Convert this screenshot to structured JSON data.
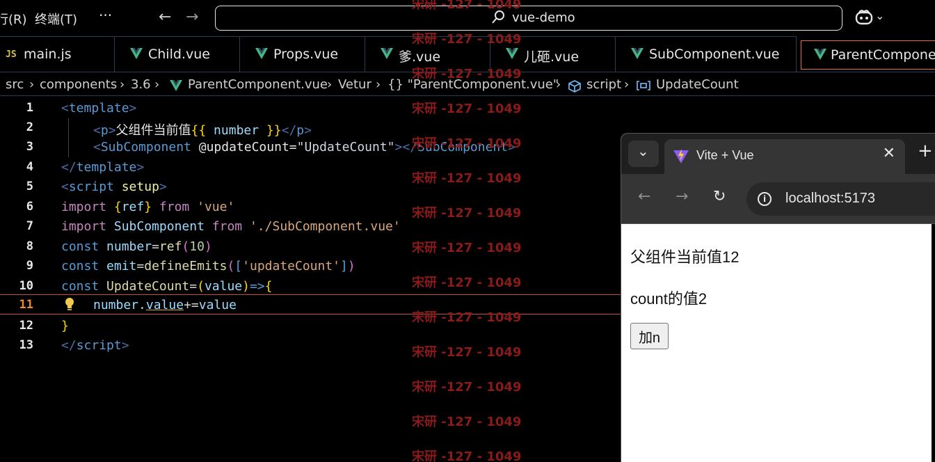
{
  "titlebar": {
    "menu_run": "行(R)",
    "menu_terminal": "终端(T)",
    "more": "···",
    "search_text": "vue-demo"
  },
  "tabs": [
    {
      "label": "main.js",
      "icon": "js-icon"
    },
    {
      "label": "Child.vue",
      "icon": "vue-icon"
    },
    {
      "label": "Props.vue",
      "icon": "vue-icon"
    },
    {
      "label": "爹.vue",
      "icon": "vue-icon"
    },
    {
      "label": "儿砸.vue",
      "icon": "vue-icon"
    },
    {
      "label": "SubComponent.vue",
      "icon": "vue-icon"
    },
    {
      "label": "ParentComponent.vue",
      "icon": "vue-icon",
      "active": true
    }
  ],
  "breadcrumb": {
    "src": "src",
    "components": "components",
    "version": "3.6",
    "file": "ParentComponent.vue",
    "vetur": "Vetur",
    "obj": "{} \"ParentComponent.vue\"",
    "script": "script",
    "symbol": "UpdateCount"
  },
  "editor": {
    "line_numbers": [
      "1",
      "2",
      "3",
      "4",
      "5",
      "6",
      "7",
      "8",
      "9",
      "10",
      "11",
      "12",
      "13"
    ],
    "current_line": 11,
    "lines": {
      "l1": [
        "<",
        "template",
        ">"
      ],
      "l2": [
        "<",
        "p",
        ">",
        "父组件当前值",
        "{{",
        " number ",
        "}}",
        "</",
        "p",
        ">"
      ],
      "l3": [
        "<",
        "SubComponent",
        " ",
        "@updateCount",
        "=",
        "\"UpdateCount\"",
        ">",
        "</",
        "SubComponent",
        ">"
      ],
      "l4": [
        "</",
        "template",
        ">"
      ],
      "l5": [
        "<",
        "script",
        " ",
        "setup",
        ">"
      ],
      "l6": [
        "import",
        " ",
        "{",
        "ref",
        "}",
        " ",
        "from",
        " ",
        "'vue'"
      ],
      "l7": [
        "import",
        " ",
        "SubComponent",
        " ",
        "from",
        " ",
        "'./SubComponent.vue'"
      ],
      "l8": [
        "const",
        " ",
        "number",
        "=",
        "ref",
        "(",
        "10",
        ")"
      ],
      "l9": [
        "const",
        " ",
        "emit",
        "=",
        "defineEmits",
        "(",
        "[",
        "'updateCount'",
        "]",
        ")"
      ],
      "l10": [
        "const",
        " ",
        "UpdateCount",
        "=",
        "(",
        "value",
        ")",
        "=>",
        "{"
      ],
      "l11": [
        "number",
        ".",
        "value",
        "+=",
        "value"
      ],
      "l12": [
        "}"
      ],
      "l13": [
        "</",
        "script",
        ">"
      ]
    }
  },
  "watermark": "宋研 -127 - 1049",
  "browser": {
    "tab_title": "Vite + Vue",
    "url": "localhost:5173",
    "parent_text": "父组件当前值12",
    "count_text": "count的值2",
    "button_label": "加n"
  },
  "colors": {
    "accent": "#e06c4b",
    "watermark": "#8b1a1a",
    "vue_green": "#41b883"
  }
}
